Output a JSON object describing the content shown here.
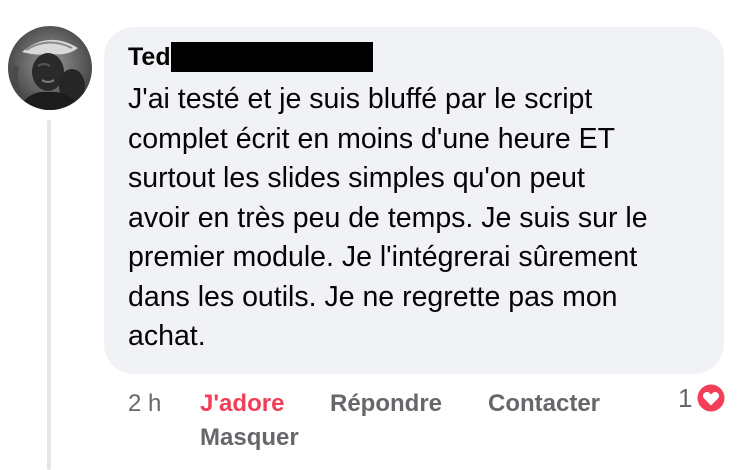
{
  "comment": {
    "author": "Ted",
    "text": "J'ai testé et je suis bluffé par le script\ncomplet écrit en moins d'une heure ET\nsurtout les slides simples qu'on peut\navoir en très peu de temps. Je suis sur le\npremier module. Je l'intégrerai sûrement\ndans les outils. Je ne regrette pas mon\nachat."
  },
  "actions": {
    "timestamp": "2 h",
    "love_label": "J'adore",
    "reply_label": "Répondre",
    "contact_label": "Contacter",
    "hide_label": "Masquer"
  },
  "reactions": {
    "count": "1",
    "icon": "heart-icon"
  },
  "colors": {
    "bubble": "#f0f2f5",
    "text": "#050505",
    "secondary": "#65676b",
    "love": "#f33e58",
    "thread_line": "#e4e6eb"
  }
}
